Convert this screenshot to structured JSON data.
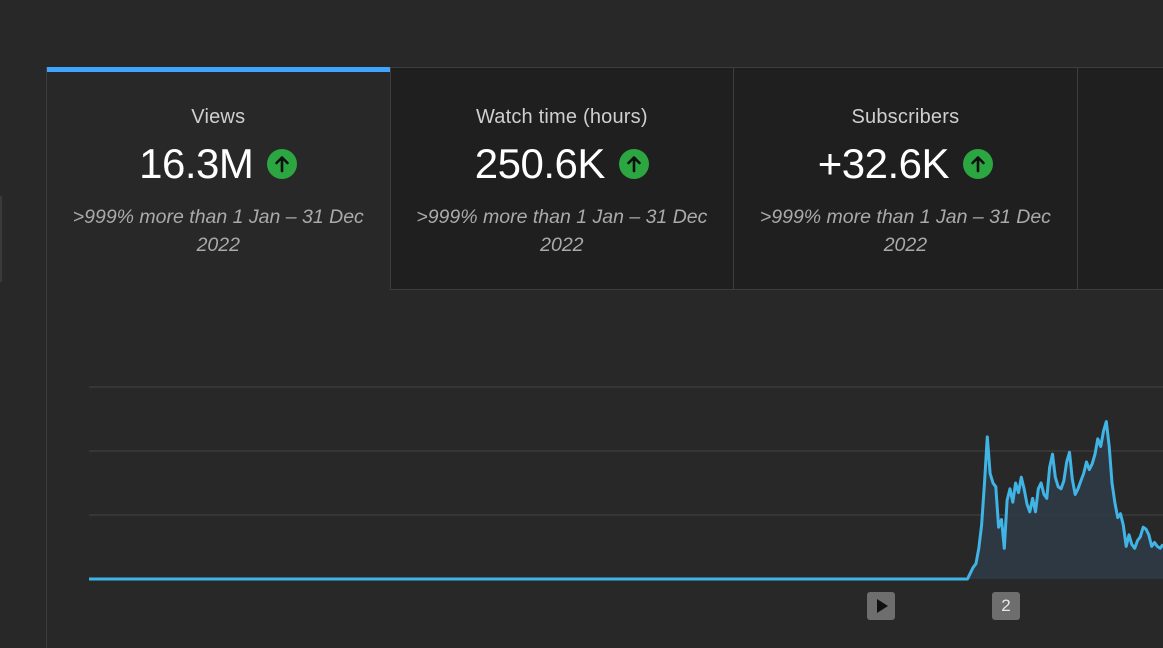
{
  "metrics": [
    {
      "title": "Views",
      "value": "16.3M",
      "comparison": ">999% more than 1 Jan – 31 Dec 2022",
      "trend": "up",
      "active": true
    },
    {
      "title": "Watch time (hours)",
      "value": "250.6K",
      "comparison": ">999% more than 1 Jan – 31 Dec 2022",
      "trend": "up",
      "active": false
    },
    {
      "title": "Subscribers",
      "value": "+32.6K",
      "comparison": ">999% more than 1 Jan – 31 Dec 2022",
      "trend": "up",
      "active": false
    }
  ],
  "colors": {
    "accent": "#3ea6ff",
    "line": "#41b4e6",
    "trend_up": "#2ba640",
    "background": "#282828",
    "tab_background": "#1f1f1f"
  },
  "icons": {
    "trend_up": "arrow-up-circle-icon",
    "play_marker": "play-icon"
  },
  "chart_markers": [
    {
      "type": "video-release",
      "label": ""
    },
    {
      "type": "numbered",
      "label": "2"
    }
  ],
  "chart_data": {
    "type": "area",
    "title": "",
    "series": [
      {
        "values": [
          0,
          0,
          0,
          0,
          0,
          0,
          0,
          0,
          0,
          0,
          0,
          0,
          0,
          0,
          0,
          0,
          0,
          0,
          0,
          0,
          0,
          0,
          0,
          0,
          0,
          0,
          0,
          0,
          0,
          0,
          0,
          0,
          0,
          0,
          0,
          0,
          0,
          0,
          0,
          0,
          0,
          0,
          0,
          0,
          0,
          0,
          0,
          0,
          0,
          0,
          0,
          0,
          0,
          0,
          0,
          0,
          0,
          0,
          0,
          0,
          0,
          0,
          0,
          0,
          0,
          0,
          0,
          0,
          0,
          0,
          0,
          0,
          0,
          0,
          0,
          0,
          0,
          0,
          0,
          0,
          0,
          0,
          0,
          0,
          0,
          0,
          0,
          0,
          0,
          0,
          0,
          0,
          0,
          0,
          0,
          0,
          0,
          0,
          0,
          0,
          0,
          0,
          0,
          0,
          0,
          0,
          0,
          0,
          0,
          0,
          0,
          0,
          0,
          0,
          0,
          0,
          0,
          0,
          0,
          0,
          0,
          0,
          0,
          0,
          0,
          0,
          0,
          0,
          0,
          0,
          0,
          0,
          0,
          0,
          0,
          0,
          0,
          0,
          0,
          0,
          0,
          0,
          0,
          0,
          0,
          0,
          0,
          0,
          0,
          0,
          0,
          0,
          0,
          0,
          0,
          0,
          0,
          0,
          0,
          0,
          0,
          0,
          0,
          0,
          0,
          0,
          0,
          0,
          0,
          0,
          0,
          0,
          0,
          0,
          0,
          0,
          0,
          0,
          0,
          0,
          0,
          0,
          0,
          0,
          0,
          0,
          0,
          0,
          0,
          0,
          0,
          0,
          0,
          0,
          0,
          0,
          0,
          0,
          0,
          0,
          0,
          0,
          0,
          0,
          0,
          0,
          0,
          0,
          0,
          0,
          0,
          0,
          0,
          0,
          0,
          0,
          0,
          0,
          0,
          0,
          0,
          0,
          0,
          0,
          0,
          0,
          0,
          0,
          0,
          0,
          0,
          0,
          0,
          0,
          0,
          0,
          0,
          0,
          0,
          0,
          0,
          0,
          0,
          0,
          0,
          0,
          0,
          0,
          0,
          0,
          0,
          0,
          0,
          0,
          0,
          0,
          0,
          0,
          0,
          0,
          0,
          0,
          0,
          0,
          0,
          0,
          0,
          0,
          0,
          0,
          0,
          0,
          0,
          0,
          0,
          0,
          0,
          0,
          0,
          0,
          0,
          0,
          0,
          0,
          0,
          0,
          0,
          0,
          0,
          0,
          0,
          0,
          0,
          0,
          0,
          0,
          0,
          0,
          0,
          0,
          0,
          0,
          0,
          0,
          0,
          0,
          0,
          0,
          0,
          0,
          0,
          0.03,
          0.06,
          0.08,
          0.16,
          0.28,
          0.5,
          0.74,
          0.55,
          0.5,
          0.48,
          0.27,
          0.31,
          0.16,
          0.41,
          0.47,
          0.4,
          0.5,
          0.45,
          0.53,
          0.47,
          0.39,
          0.35,
          0.42,
          0.35,
          0.47,
          0.5,
          0.44,
          0.42,
          0.58,
          0.65,
          0.53,
          0.48,
          0.47,
          0.51,
          0.61,
          0.66,
          0.52,
          0.44,
          0.47,
          0.51,
          0.55,
          0.61,
          0.57,
          0.6,
          0.65,
          0.73,
          0.69,
          0.77,
          0.82,
          0.69,
          0.5,
          0.4,
          0.32,
          0.34,
          0.28,
          0.17,
          0.23,
          0.18,
          0.16,
          0.2,
          0.22,
          0.27,
          0.26,
          0.23,
          0.17,
          0.19,
          0.17,
          0.16,
          0.18
        ]
      }
    ],
    "ylim": [
      0,
      1
    ],
    "grid": true,
    "legend": "none"
  }
}
